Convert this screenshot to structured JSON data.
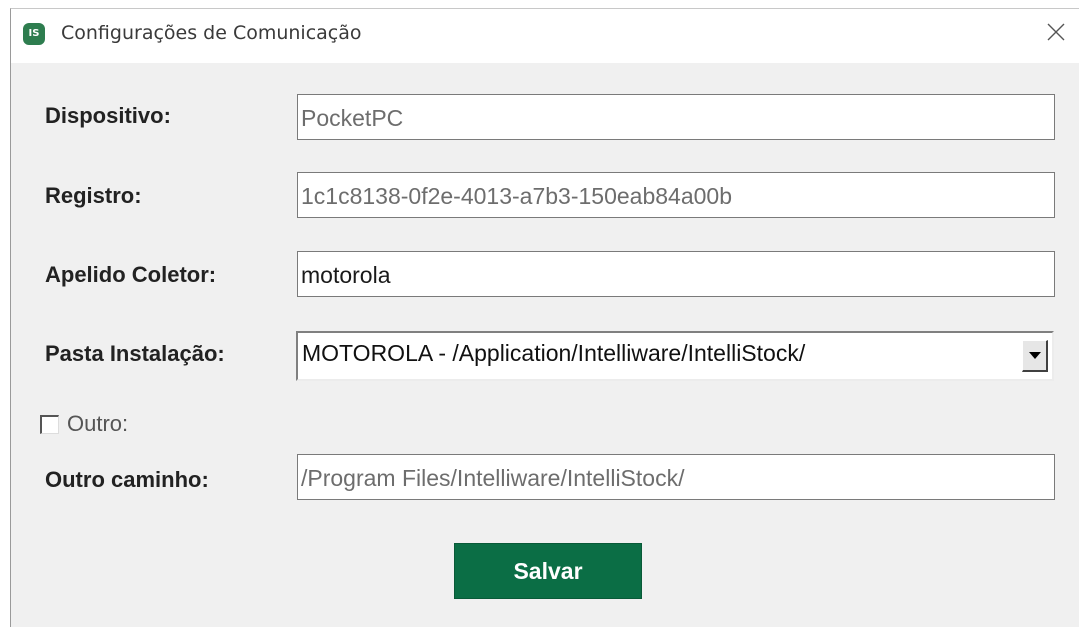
{
  "window": {
    "title": "Configurações de Comunicação",
    "icon_text": "IS",
    "icon": "app-logo-icon",
    "close_icon": "close-icon"
  },
  "form": {
    "device": {
      "label": "Dispositivo:",
      "value": "PocketPC"
    },
    "registry": {
      "label": "Registro:",
      "value": "1c1c8138-0f2e-4013-a7b3-150eab84a00b"
    },
    "collector_nickname": {
      "label": "Apelido Coletor:",
      "value": "motorola"
    },
    "install_folder": {
      "label": "Pasta Instalação:",
      "selected": "MOTOROLA - /Application/Intelliware/IntelliStock/"
    },
    "other": {
      "label": "Outro:",
      "checked": false
    },
    "other_path": {
      "label": "Outro caminho:",
      "value": "/Program Files/Intelliware/IntelliStock/"
    }
  },
  "actions": {
    "save_label": "Salvar"
  },
  "colors": {
    "accent": "#0b6e45",
    "window_bg": "#f0f0f0",
    "icon_bg": "#2e7d4f"
  }
}
